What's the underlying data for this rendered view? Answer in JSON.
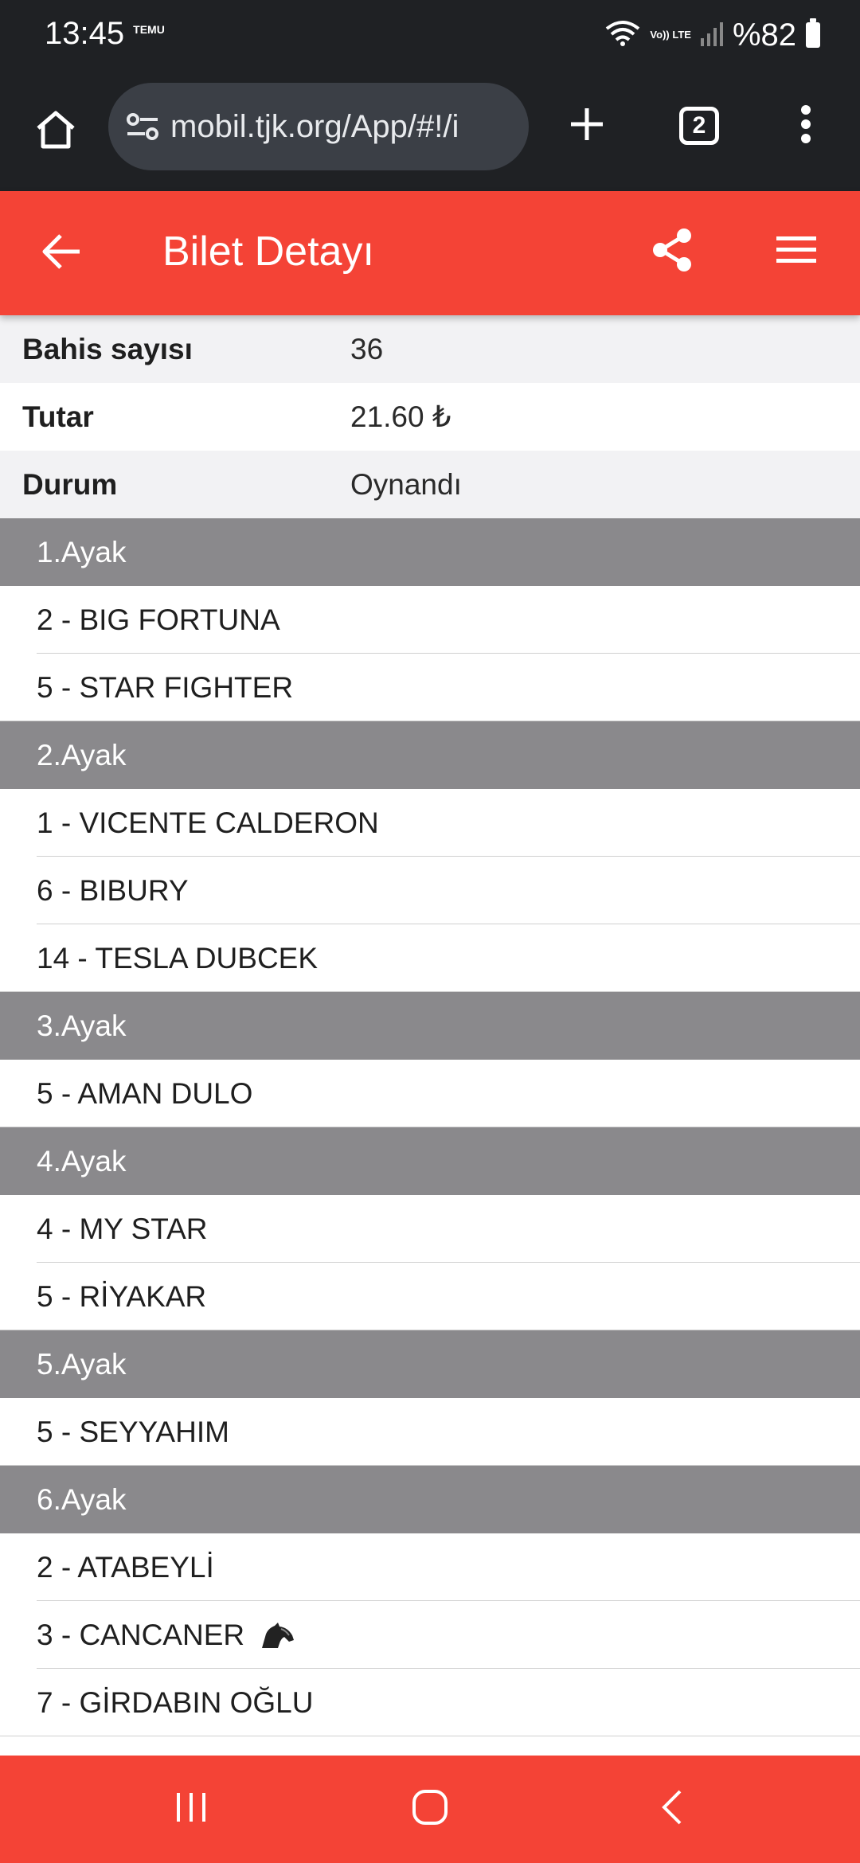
{
  "status_bar": {
    "time": "13:45",
    "temu_label": "TEMU",
    "volte_label": "Vo)) LTE",
    "battery_text": "%82"
  },
  "browser": {
    "url": "mobil.tjk.org/App/#!/i",
    "tab_count": "2"
  },
  "header": {
    "title": "Bilet Detayı"
  },
  "info": [
    {
      "label": "Bahis sayısı",
      "value": "36"
    },
    {
      "label": "Tutar",
      "value": "21.60 ₺"
    },
    {
      "label": "Durum",
      "value": "Oynandı"
    }
  ],
  "legs": [
    {
      "title": "1.Ayak",
      "horses": [
        "2 - BIG FORTUNA",
        "5 - STAR FIGHTER"
      ]
    },
    {
      "title": "2.Ayak",
      "horses": [
        "1 - VICENTE CALDERON",
        "6 - BIBURY",
        "14 - TESLA DUBCEK"
      ]
    },
    {
      "title": "3.Ayak",
      "horses": [
        "5 - AMAN DULO"
      ]
    },
    {
      "title": "4.Ayak",
      "horses": [
        "4 - MY STAR",
        "5 - RİYAKAR"
      ]
    },
    {
      "title": "5.Ayak",
      "horses": [
        "5 - SEYYAHIM"
      ]
    },
    {
      "title": "6.Ayak",
      "horses": [
        "2 - ATABEYLİ",
        "3 - CANCANER",
        "7 - GİRDABIN OĞLU"
      ]
    }
  ],
  "icons": {
    "home": "home-icon",
    "tune": "tune-icon",
    "plus": "plus-icon",
    "more": "more-vert-icon",
    "back": "arrow-back-icon",
    "share": "share-icon",
    "menu": "hamburger-menu-icon",
    "horse": "horse-head-icon"
  },
  "colors": {
    "brand_red": "#f44336",
    "leg_header_gray": "#8a898c",
    "browser_dark": "#1f2124"
  }
}
